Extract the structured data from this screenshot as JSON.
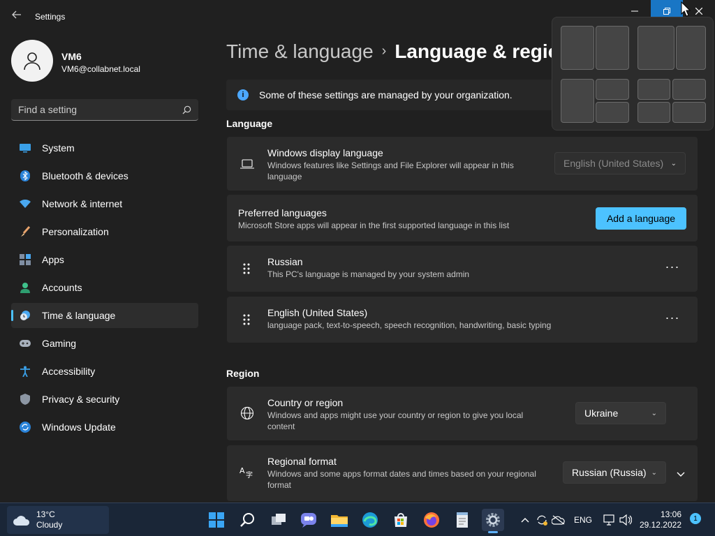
{
  "window": {
    "title": "Settings"
  },
  "user": {
    "name": "VM6",
    "email": "VM6@collabnet.local"
  },
  "search": {
    "placeholder": "Find a setting"
  },
  "sidebar": {
    "items": [
      {
        "label": "System",
        "icon": "system-icon"
      },
      {
        "label": "Bluetooth & devices",
        "icon": "bluetooth-icon"
      },
      {
        "label": "Network & internet",
        "icon": "wifi-icon"
      },
      {
        "label": "Personalization",
        "icon": "brush-icon"
      },
      {
        "label": "Apps",
        "icon": "apps-icon"
      },
      {
        "label": "Accounts",
        "icon": "accounts-icon"
      },
      {
        "label": "Time & language",
        "icon": "clock-globe-icon",
        "selected": true
      },
      {
        "label": "Gaming",
        "icon": "gamepad-icon"
      },
      {
        "label": "Accessibility",
        "icon": "accessibility-icon"
      },
      {
        "label": "Privacy & security",
        "icon": "shield-icon"
      },
      {
        "label": "Windows Update",
        "icon": "update-icon"
      }
    ]
  },
  "header": {
    "parent": "Time & language",
    "current": "Language & region"
  },
  "banner": {
    "text": "Some of these settings are managed by your organization."
  },
  "language": {
    "section_title": "Language",
    "display_language": {
      "title": "Windows display language",
      "desc": "Windows features like Settings and File Explorer will appear in this language",
      "value": "English (United States)"
    },
    "preferred": {
      "title": "Preferred languages",
      "desc": "Microsoft Store apps will appear in the first supported language in this list",
      "button": "Add a language"
    },
    "list": [
      {
        "name": "Russian",
        "desc": "This PC's language is managed by your system admin"
      },
      {
        "name": "English (United States)",
        "desc": "language pack, text-to-speech, speech recognition, handwriting, basic typing"
      }
    ]
  },
  "region": {
    "section_title": "Region",
    "country": {
      "title": "Country or region",
      "desc": "Windows and apps might use your country or region to give you local content",
      "value": "Ukraine"
    },
    "format": {
      "title": "Regional format",
      "desc": "Windows and some apps format dates and times based on your regional format",
      "value": "Russian (Russia)"
    }
  },
  "taskbar": {
    "weather_temp": "13°C",
    "weather_cond": "Cloudy",
    "lang": "ENG",
    "time": "13:06",
    "date": "29.12.2022",
    "notifications": "1"
  },
  "colors": {
    "accent": "#4cc2ff",
    "background": "#202020",
    "card": "#2b2b2b"
  }
}
